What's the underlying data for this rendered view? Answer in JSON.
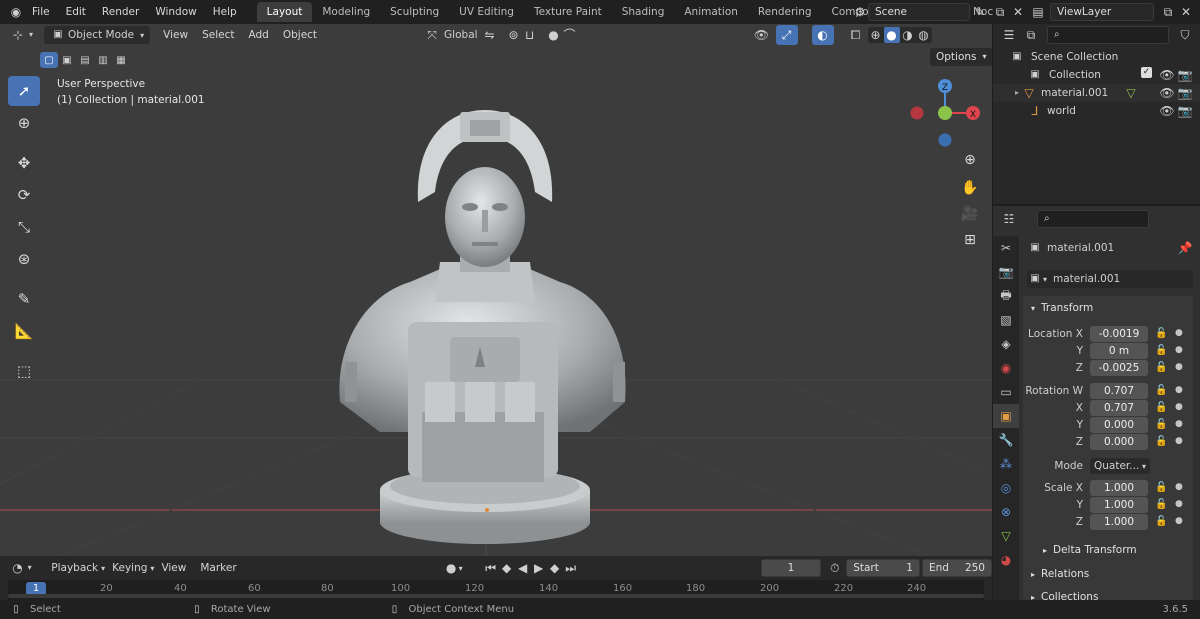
{
  "topbar": {
    "menus": [
      "File",
      "Edit",
      "Render",
      "Window",
      "Help"
    ],
    "workspaces": [
      "Layout",
      "Modeling",
      "Sculpting",
      "UV Editing",
      "Texture Paint",
      "Shading",
      "Animation",
      "Rendering",
      "Compositing",
      "Geometry Noc"
    ],
    "active_workspace": "Layout",
    "scene_name": "Scene",
    "view_layer": "ViewLayer"
  },
  "viewport": {
    "mode": "Object Mode",
    "menus": [
      "View",
      "Select",
      "Add",
      "Object"
    ],
    "transform_orientation": "Global",
    "options_label": "Options",
    "info_line1": "User Perspective",
    "info_line2": "(1) Collection | material.001",
    "tools": [
      "select-box",
      "cursor",
      "move",
      "rotate",
      "scale",
      "transform",
      "annotate",
      "measure",
      "add-cube"
    ]
  },
  "timeline": {
    "menus": [
      "Playback",
      "Keying",
      "View",
      "Marker"
    ],
    "current_frame": "1",
    "start_label": "Start",
    "start_value": "1",
    "end_label": "End",
    "end_value": "250",
    "ruler_current": "1",
    "ruler_ticks": [
      "20",
      "40",
      "60",
      "80",
      "100",
      "120",
      "140",
      "160",
      "180",
      "200",
      "220",
      "240"
    ]
  },
  "statusbar": {
    "select": "Select",
    "rotate_view": "Rotate View",
    "context_menu": "Object Context Menu",
    "version": "3.6.5"
  },
  "outliner": {
    "scene_collection": "Scene Collection",
    "items": [
      {
        "name": "Collection",
        "type": "collection"
      },
      {
        "name": "material.001",
        "type": "mesh"
      },
      {
        "name": "world",
        "type": "empty"
      }
    ]
  },
  "properties": {
    "object_name": "material.001",
    "datablock_name": "material.001",
    "transform_title": "Transform",
    "location": {
      "label": "Location X",
      "x": "-0.0019",
      "y": "0 m",
      "z": "-0.0025"
    },
    "rotation": {
      "label": "Rotation W",
      "w": "0.707",
      "x": "0.707",
      "y": "0.000",
      "z": "0.000"
    },
    "mode_label": "Mode",
    "mode_value": "Quater...",
    "scale": {
      "label": "Scale X",
      "x": "1.000",
      "y": "1.000",
      "z": "1.000"
    },
    "axis_y": "Y",
    "axis_z": "Z",
    "axis_x": "X",
    "delta_transform": "Delta Transform",
    "relations": "Relations",
    "collections": "Collections"
  },
  "colors": {
    "accent_blue": "#4772b3",
    "object_orange": "#e29b45",
    "axis_x_red": "#e0454f",
    "axis_y_green": "#8bc34a",
    "axis_z_blue": "#4f8ed8"
  }
}
